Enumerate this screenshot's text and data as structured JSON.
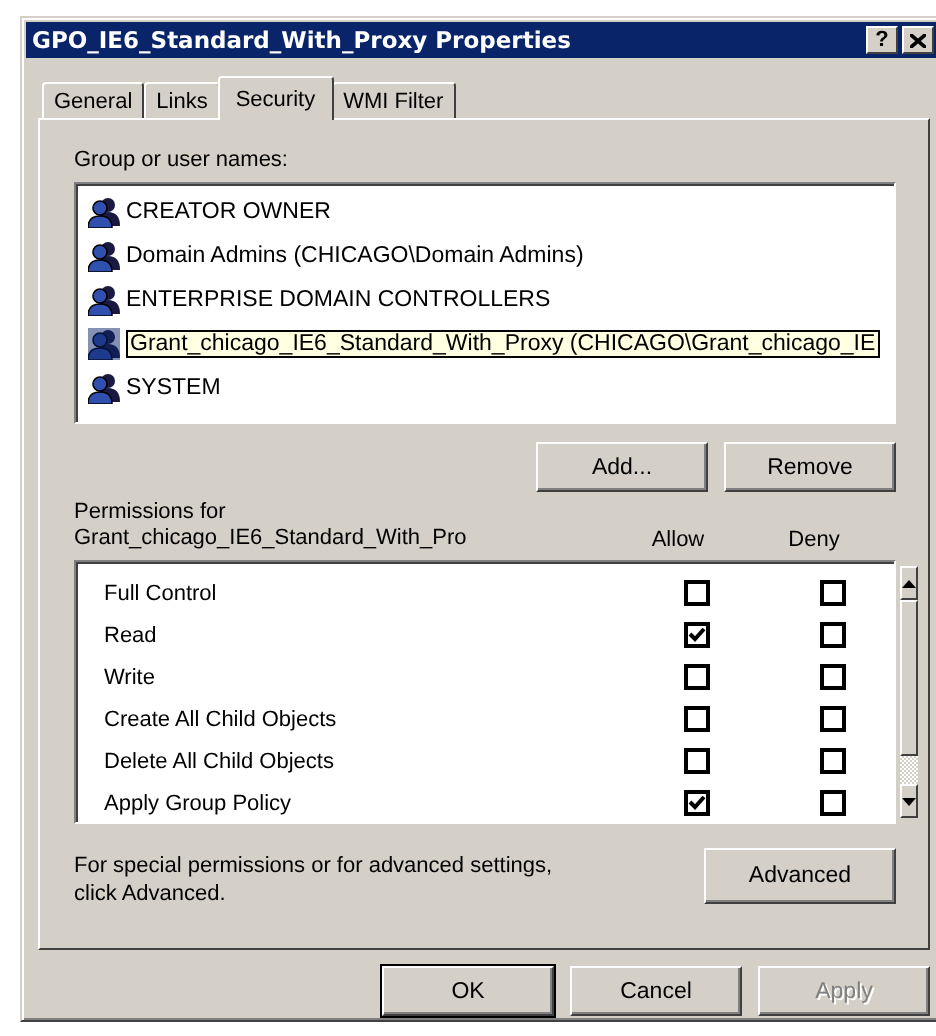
{
  "window": {
    "title": "GPO_IE6_Standard_With_Proxy Properties",
    "help": "?"
  },
  "tabs": [
    {
      "label": "General",
      "selected": false
    },
    {
      "label": "Links",
      "selected": false
    },
    {
      "label": "Security",
      "selected": true
    },
    {
      "label": "WMI Filter",
      "selected": false
    }
  ],
  "group_list": {
    "label": "Group or user names:",
    "items": [
      {
        "name": "CREATOR OWNER",
        "selected": false
      },
      {
        "name": "Domain Admins (CHICAGO\\Domain Admins)",
        "selected": false
      },
      {
        "name": "ENTERPRISE DOMAIN CONTROLLERS",
        "selected": false
      },
      {
        "name": "Grant_chicago_IE6_Standard_With_Proxy (CHICAGO\\Grant_chicago_IE",
        "selected": true
      },
      {
        "name": "SYSTEM",
        "selected": false
      }
    ]
  },
  "group_buttons": [
    "Add...",
    "Remove"
  ],
  "permissions": {
    "label": "Permissions for",
    "subject": "Grant_chicago_IE6_Standard_With_Pro",
    "columns": [
      "Allow",
      "Deny"
    ],
    "rows": [
      {
        "name": "Full Control",
        "allow": false,
        "deny": false
      },
      {
        "name": "Read",
        "allow": true,
        "deny": false
      },
      {
        "name": "Write",
        "allow": false,
        "deny": false
      },
      {
        "name": "Create All Child Objects",
        "allow": false,
        "deny": false
      },
      {
        "name": "Delete All Child Objects",
        "allow": false,
        "deny": false
      },
      {
        "name": "Apply Group Policy",
        "allow": true,
        "deny": false
      }
    ]
  },
  "advanced": {
    "note": "For special permissions or for advanced settings, click Advanced.",
    "button": "Advanced"
  },
  "buttons": [
    {
      "label": "OK",
      "default": true,
      "disabled": false
    },
    {
      "label": "Cancel",
      "default": false,
      "disabled": false
    },
    {
      "label": "Apply",
      "default": false,
      "disabled": true
    }
  ]
}
